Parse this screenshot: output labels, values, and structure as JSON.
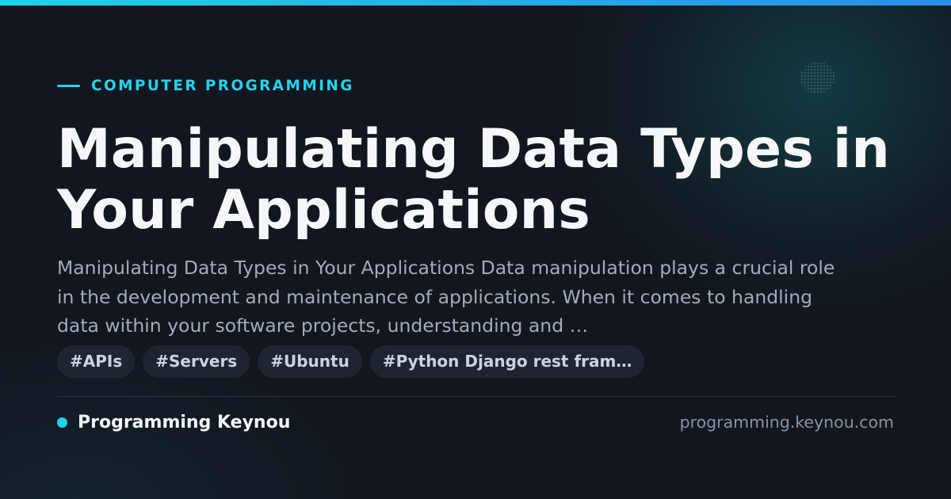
{
  "category": {
    "label": "COMPUTER PROGRAMMING"
  },
  "article": {
    "title": "Manipulating Data Types in Your Applications",
    "excerpt": "Manipulating Data Types in Your Applications Data manipulation plays a crucial role in the development and maintenance of applications. When it comes to handling data within your software projects, understanding and …"
  },
  "tags": [
    "#APIs",
    "#Servers",
    "#Ubuntu",
    "#Python Django rest fram…"
  ],
  "footer": {
    "brand_name": "Programming Keynou",
    "domain": "programming.keynou.com"
  },
  "colors": {
    "accent": "#22d3ee",
    "background": "#12161e",
    "title": "#f5f7fa",
    "excerpt": "#a3acb9",
    "tag_background": "#1f2530"
  }
}
